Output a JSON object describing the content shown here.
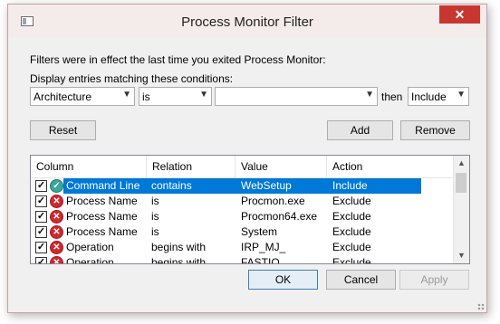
{
  "window": {
    "title": "Process Monitor Filter",
    "close_glyph": "✕"
  },
  "info_text": "Filters were in effect the last time you exited Process Monitor:",
  "display_label": "Display entries matching these conditions:",
  "condition": {
    "column": "Architecture",
    "relation": "is",
    "value": "",
    "then_label": "then",
    "action": "Include"
  },
  "buttons": {
    "reset": "Reset",
    "add": "Add",
    "remove": "Remove",
    "ok": "OK",
    "cancel": "Cancel",
    "apply": "Apply"
  },
  "list": {
    "headers": [
      "Column",
      "Relation",
      "Value",
      "Action"
    ],
    "rows": [
      {
        "checked": true,
        "type": "include",
        "column": "Command Line",
        "relation": "contains",
        "value": "WebSetup",
        "action": "Include",
        "selected": true
      },
      {
        "checked": true,
        "type": "exclude",
        "column": "Process Name",
        "relation": "is",
        "value": "Procmon.exe",
        "action": "Exclude",
        "selected": false
      },
      {
        "checked": true,
        "type": "exclude",
        "column": "Process Name",
        "relation": "is",
        "value": "Procmon64.exe",
        "action": "Exclude",
        "selected": false
      },
      {
        "checked": true,
        "type": "exclude",
        "column": "Process Name",
        "relation": "is",
        "value": "System",
        "action": "Exclude",
        "selected": false
      },
      {
        "checked": true,
        "type": "exclude",
        "column": "Operation",
        "relation": "begins with",
        "value": "IRP_MJ_",
        "action": "Exclude",
        "selected": false
      },
      {
        "checked": true,
        "type": "exclude",
        "column": "Operation",
        "relation": "begins with",
        "value": "FASTIO_",
        "action": "Exclude",
        "selected": false
      }
    ]
  },
  "colors": {
    "selection": "#0078d7",
    "close_button": "#c7372f",
    "include_icon": "#3aa79b",
    "exclude_icon": "#d3262e"
  },
  "icons": {
    "include": "include-check-icon",
    "exclude": "exclude-x-icon"
  }
}
